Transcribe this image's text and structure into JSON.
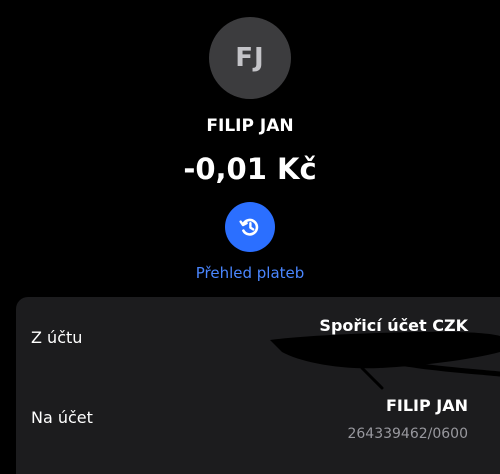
{
  "recipient": {
    "initials": "FJ",
    "name": "FILIP JAN"
  },
  "transaction": {
    "amount": "-0,01 Kč"
  },
  "actions": {
    "history_label": "Přehled plateb",
    "history_icon": "history-icon"
  },
  "details": {
    "from_label": "Z účtu",
    "from_value": "Spořicí účet CZK",
    "to_label": "Na účet",
    "to_name": "FILIP JAN",
    "to_account": "264339462/0600"
  },
  "colors": {
    "background": "#000000",
    "card": "#1c1c1e",
    "accent": "#2b6fff",
    "link": "#4a86ff",
    "avatar": "#3c3c3e"
  }
}
